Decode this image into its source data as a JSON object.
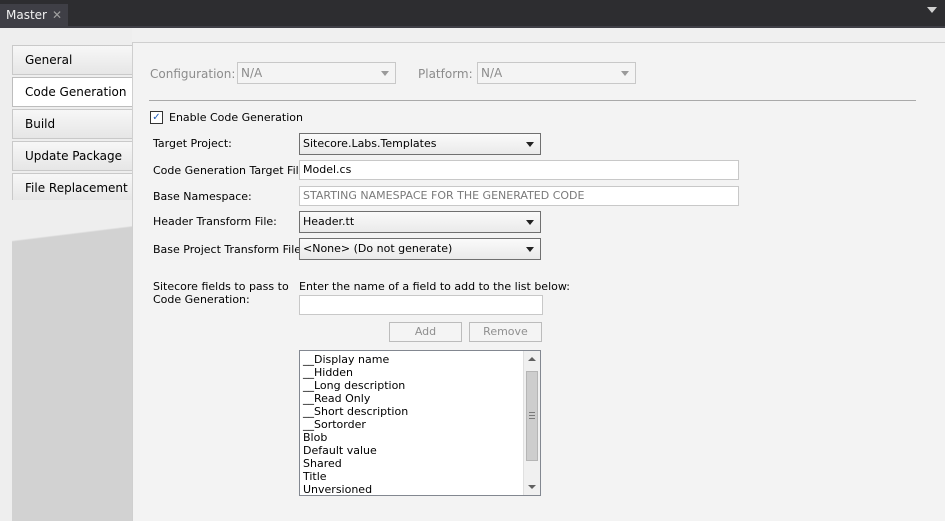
{
  "document_tab": {
    "title": "Master",
    "close_glyph": "✕"
  },
  "side_tabs": [
    {
      "label": "General"
    },
    {
      "label": "Code Generation"
    },
    {
      "label": "Build"
    },
    {
      "label": "Update Package"
    },
    {
      "label": "File Replacement"
    }
  ],
  "toolbar": {
    "configuration_label": "Configuration:",
    "configuration_value": "N/A",
    "platform_label": "Platform:",
    "platform_value": "N/A"
  },
  "form": {
    "enable_label": "Enable Code Generation",
    "enable_checked": true,
    "target_project_label": "Target Project:",
    "target_project_value": "Sitecore.Labs.Templates",
    "target_file_label": "Code Generation Target File:",
    "target_file_value": "Model.cs",
    "namespace_label": "Base Namespace:",
    "namespace_placeholder": "STARTING NAMESPACE FOR THE GENERATED CODE",
    "header_label": "Header Transform File:",
    "header_value": "Header.tt",
    "base_project_label": "Base Project Transform File:",
    "base_project_value": "<None> (Do not generate)",
    "fields_label_line1": "Sitecore fields to pass to",
    "fields_label_line2": "Code Generation:",
    "field_prompt": "Enter the name of a field to add to the list below:",
    "field_input_value": "",
    "add_label": "Add",
    "remove_label": "Remove"
  },
  "field_list": [
    "__Display name",
    "__Hidden",
    "__Long description",
    "__Read Only",
    "__Short description",
    "__Sortorder",
    "Blob",
    "Default value",
    "Shared",
    "Title",
    "Unversioned"
  ],
  "icons": {
    "check": "✓",
    "close": "close-icon",
    "dropdown": "chevron-down-icon"
  },
  "colors": {
    "chrome_dark": "#2d2d30",
    "panel_bg": "#f0f0f0",
    "checkbox_mark": "#1e5bb8"
  }
}
